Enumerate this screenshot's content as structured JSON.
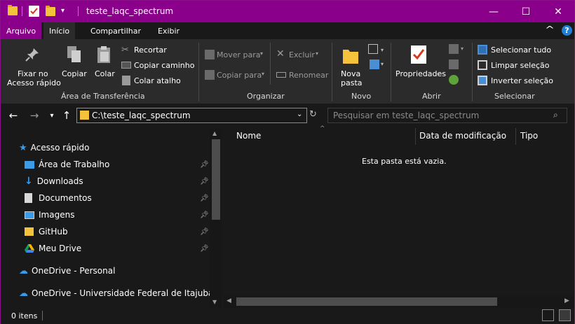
{
  "window": {
    "title": "teste_laqc_spectrum",
    "frame_color": "#8b008b",
    "background": "#191919"
  },
  "quick_access_toolbar": {
    "icons": [
      "folder-icon",
      "properties-check-icon",
      "new-folder-icon",
      "customize-dropdown-icon"
    ]
  },
  "window_controls": {
    "minimize": "—",
    "maximize": "☐",
    "close": "✕"
  },
  "ribbon_tabs": [
    {
      "label": "Arquivo"
    },
    {
      "label": "Início"
    },
    {
      "label": "Compartilhar"
    },
    {
      "label": "Exibir"
    }
  ],
  "ribbon_right": {
    "collapse": "^",
    "help": "?"
  },
  "ribbon": {
    "clipboard": {
      "pin_label_1": "Fixar no",
      "pin_label_2": "Acesso rápido",
      "copy_label": "Copiar",
      "paste_label": "Colar",
      "cut_label": "Recortar",
      "copy_path_label": "Copiar caminho",
      "paste_shortcut_label": "Colar atalho",
      "group_label": "Área de Transferência"
    },
    "organize": {
      "move_to_label": "Mover para",
      "copy_to_label": "Copiar para",
      "delete_label": "Excluir",
      "rename_label": "Renomear",
      "group_label": "Organizar"
    },
    "new": {
      "new_folder_label_1": "Nova",
      "new_folder_label_2": "pasta",
      "group_label": "Novo"
    },
    "open": {
      "properties_label": "Propriedades",
      "group_label": "Abrir"
    },
    "select": {
      "select_all_label": "Selecionar tudo",
      "select_none_label": "Limpar seleção",
      "invert_label": "Inverter seleção",
      "group_label": "Selecionar"
    }
  },
  "address_bar": {
    "path": "C:\\teste_laqc_spectrum",
    "search_placeholder": "Pesquisar em teste_laqc_spectrum"
  },
  "nav_pane": {
    "quick_access_label": "Acesso rápido",
    "items": [
      {
        "label": "Área de Trabalho",
        "icon": "desktop-icon",
        "pinned": true
      },
      {
        "label": "Downloads",
        "icon": "download-arrow-icon",
        "pinned": true
      },
      {
        "label": "Documentos",
        "icon": "document-icon",
        "pinned": true
      },
      {
        "label": "Imagens",
        "icon": "pictures-icon",
        "pinned": true
      },
      {
        "label": "GitHub",
        "icon": "folder-icon",
        "pinned": true
      },
      {
        "label": "Meu Drive",
        "icon": "google-drive-icon",
        "pinned": true
      }
    ],
    "onedrive_personal": "OneDrive - Personal",
    "onedrive_org": "OneDrive - Universidade Federal de Itajubá"
  },
  "file_list": {
    "columns": [
      {
        "label": "Nome"
      },
      {
        "label": "Data de modificação"
      },
      {
        "label": "Tipo"
      }
    ],
    "empty_message": "Esta pasta está vazia."
  },
  "status_bar": {
    "item_count": "0 itens"
  }
}
